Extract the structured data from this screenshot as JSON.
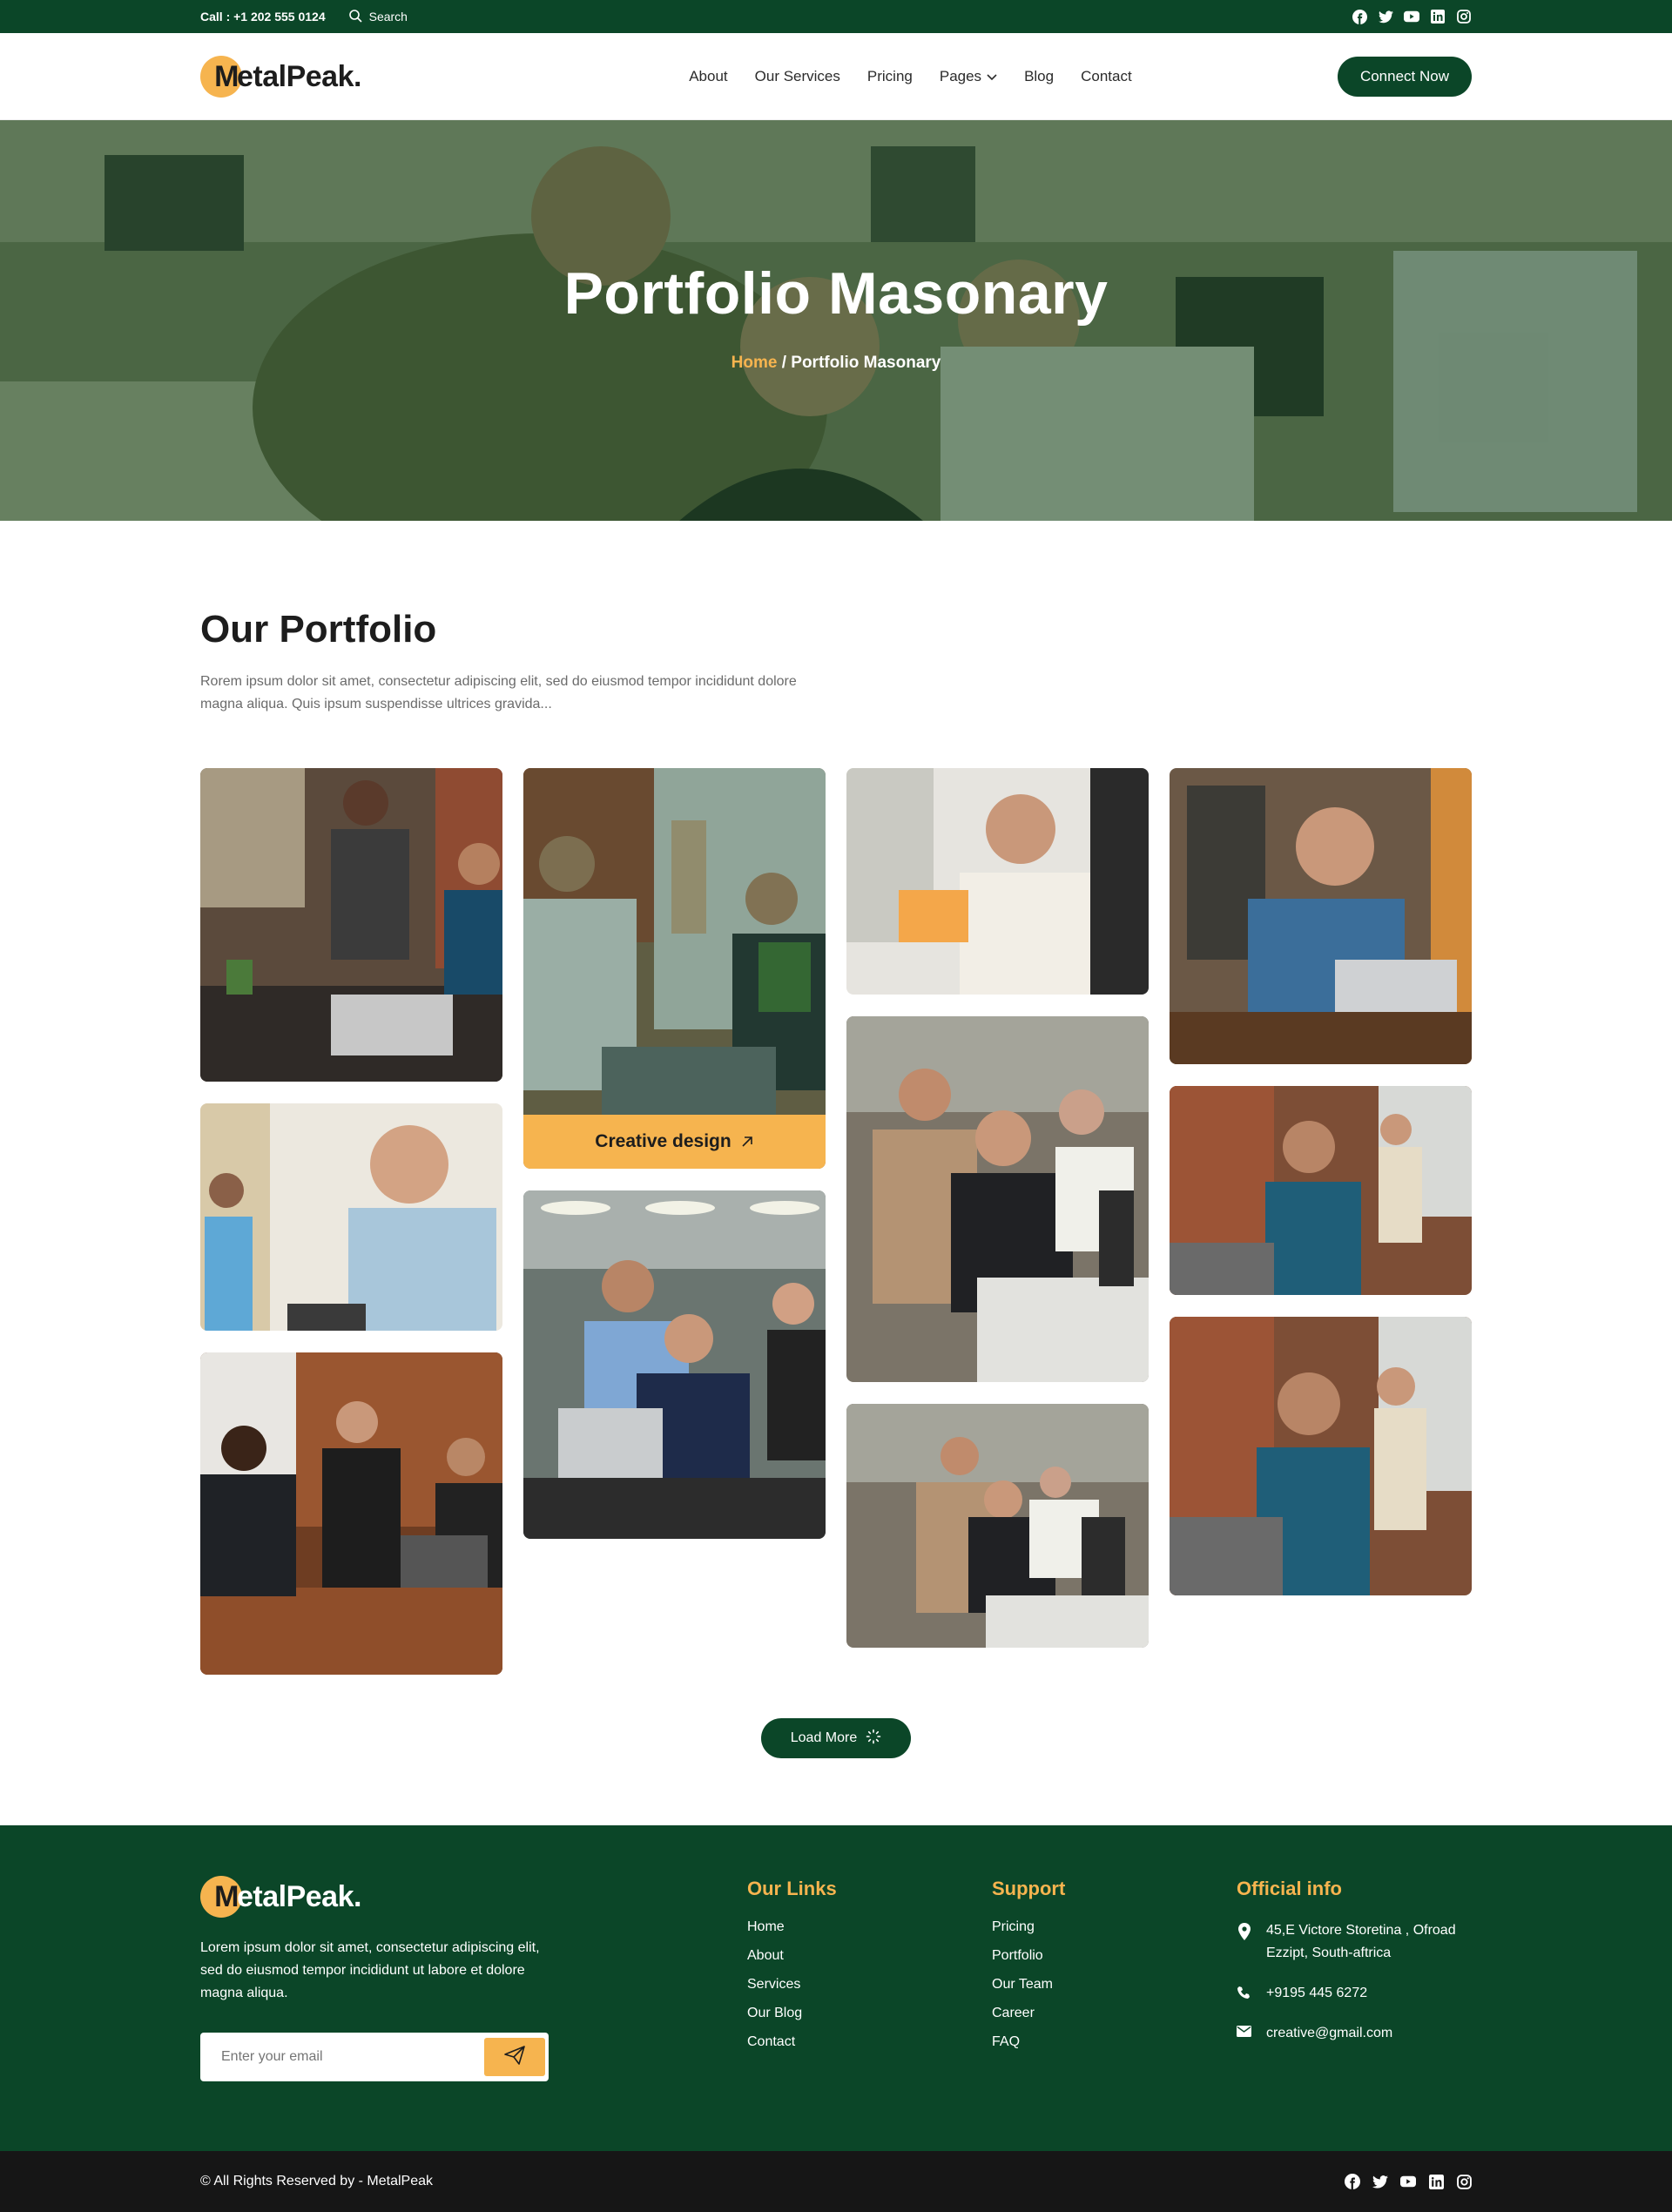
{
  "topbar": {
    "call": "Call : +1 202 555 0124",
    "search": "Search",
    "socials": [
      "facebook-icon",
      "twitter-icon",
      "youtube-icon",
      "linkedin-icon",
      "instagram-icon"
    ]
  },
  "brand": {
    "initial": "M",
    "rest": "etalPeak."
  },
  "nav": {
    "items": [
      "About",
      "Our Services",
      "Pricing",
      "Pages",
      "Blog",
      "Contact"
    ],
    "cta": "Connect Now"
  },
  "hero": {
    "title": "Portfolio Masonary",
    "crumb_home": "Home",
    "crumb_sep": " / ",
    "crumb_current": "Portfolio Masonary"
  },
  "portfolio": {
    "heading": "Our Portfolio",
    "lead": "Rorem ipsum dolor sit amet, consectetur adipiscing elit, sed do eiusmod tempor incididunt dolore magna aliqua. Quis ipsum suspendisse ultrices gravida...",
    "caption": "Creative design",
    "load_more": "Load More"
  },
  "footer": {
    "about": "Lorem ipsum dolor sit amet, consectetur adipiscing elit, sed do eiusmod tempor incididunt ut labore et dolore magna aliqua.",
    "email_placeholder": "Enter your email",
    "links_title": "Our Links",
    "links": [
      "Home",
      "About",
      "Services",
      "Our Blog",
      "Contact"
    ],
    "support_title": "Support",
    "support": [
      "Pricing",
      "Portfolio",
      "Our Team",
      "Career",
      "FAQ"
    ],
    "info_title": "Official info",
    "address": "45,E Victore Storetina , Ofroad Ezzipt, South-aftrica",
    "phone": "+9195 445 6272",
    "email": "creative@gmail.com"
  },
  "bottom": {
    "copyright": "© All Rights Reserved by - MetalPeak"
  },
  "colors": {
    "primary": "#0b4628",
    "accent": "#f6b44f",
    "dark": "#161616"
  }
}
